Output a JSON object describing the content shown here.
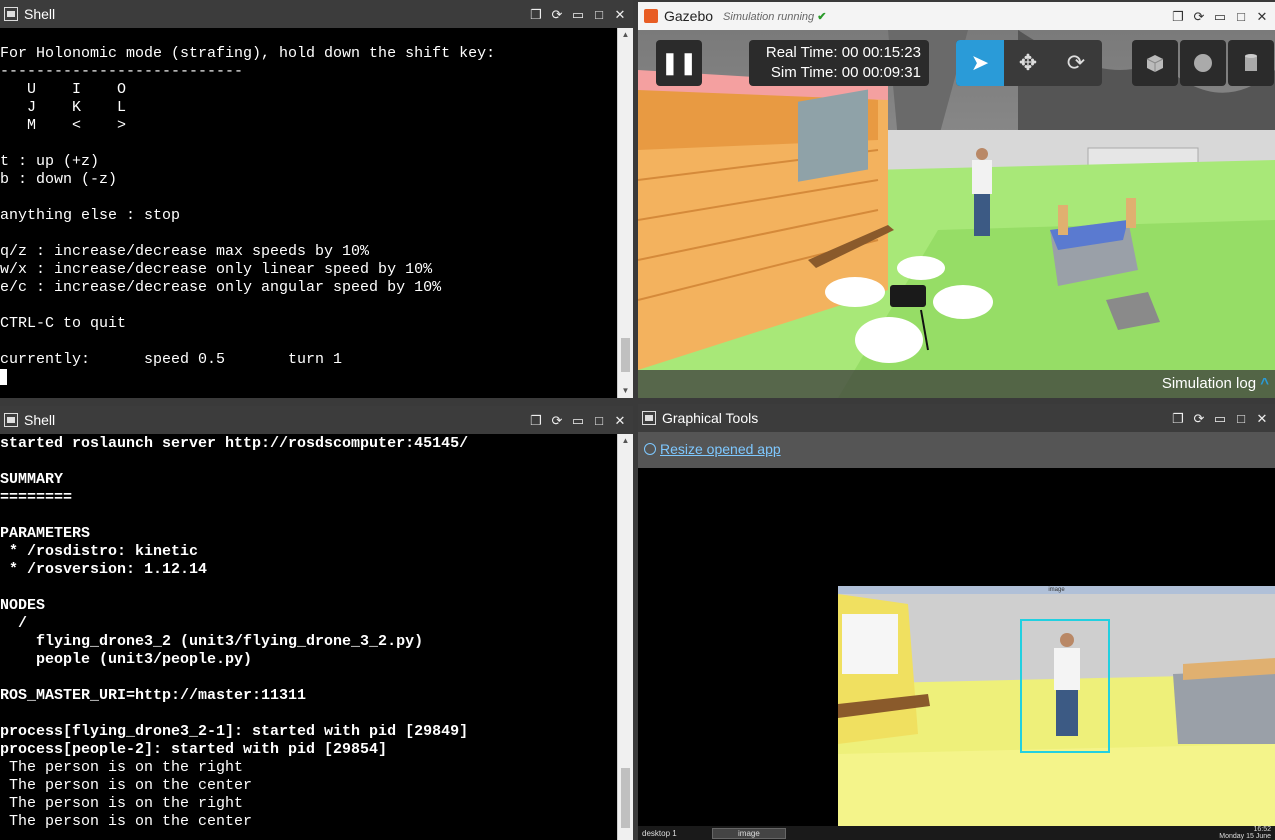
{
  "shell_top": {
    "title": "Shell",
    "lines": [
      "For Holonomic mode (strafing), hold down the shift key:",
      "---------------------------",
      "   U    I    O",
      "   J    K    L",
      "   M    <    >",
      "",
      "t : up (+z)",
      "b : down (-z)",
      "",
      "anything else : stop",
      "",
      "q/z : increase/decrease max speeds by 10%",
      "w/x : increase/decrease only linear speed by 10%",
      "e/c : increase/decrease only angular speed by 10%",
      "",
      "CTRL-C to quit",
      "",
      "currently:      speed 0.5       turn 1"
    ]
  },
  "shell_bottom": {
    "title": "Shell",
    "lines": [
      "started roslaunch server http://rosdscomputer:45145/",
      "",
      "SUMMARY",
      "========",
      "",
      "PARAMETERS",
      " * /rosdistro: kinetic",
      " * /rosversion: 1.12.14",
      "",
      "NODES",
      "  /",
      "    flying_drone3_2 (unit3/flying_drone_3_2.py)",
      "    people (unit3/people.py)",
      "",
      "ROS_MASTER_URI=http://master:11311",
      "",
      "process[flying_drone3_2-1]: started with pid [29849]",
      "process[people-2]: started with pid [29854]",
      " The person is on the right",
      " The person is on the center",
      " The person is on the right",
      " The person is on the center"
    ]
  },
  "gazebo": {
    "title": "Gazebo",
    "status": "Simulation running",
    "real_time_label": "Real Time:",
    "real_time": "00 00:15:23",
    "sim_time_label": "Sim Time:",
    "sim_time": "00 00:09:31",
    "sim_log": "Simulation log"
  },
  "graphical_tools": {
    "title": "Graphical Tools",
    "resize_link": "Resize opened app",
    "image_window_title": "image",
    "taskbar_desktop": "desktop 1",
    "taskbar_image": "image",
    "clock_time": "16:52",
    "clock_date": "Monday 15 June"
  },
  "colors": {
    "accent": "#2a9bd8",
    "grass": "#9be36a",
    "house": "#f0a650"
  }
}
